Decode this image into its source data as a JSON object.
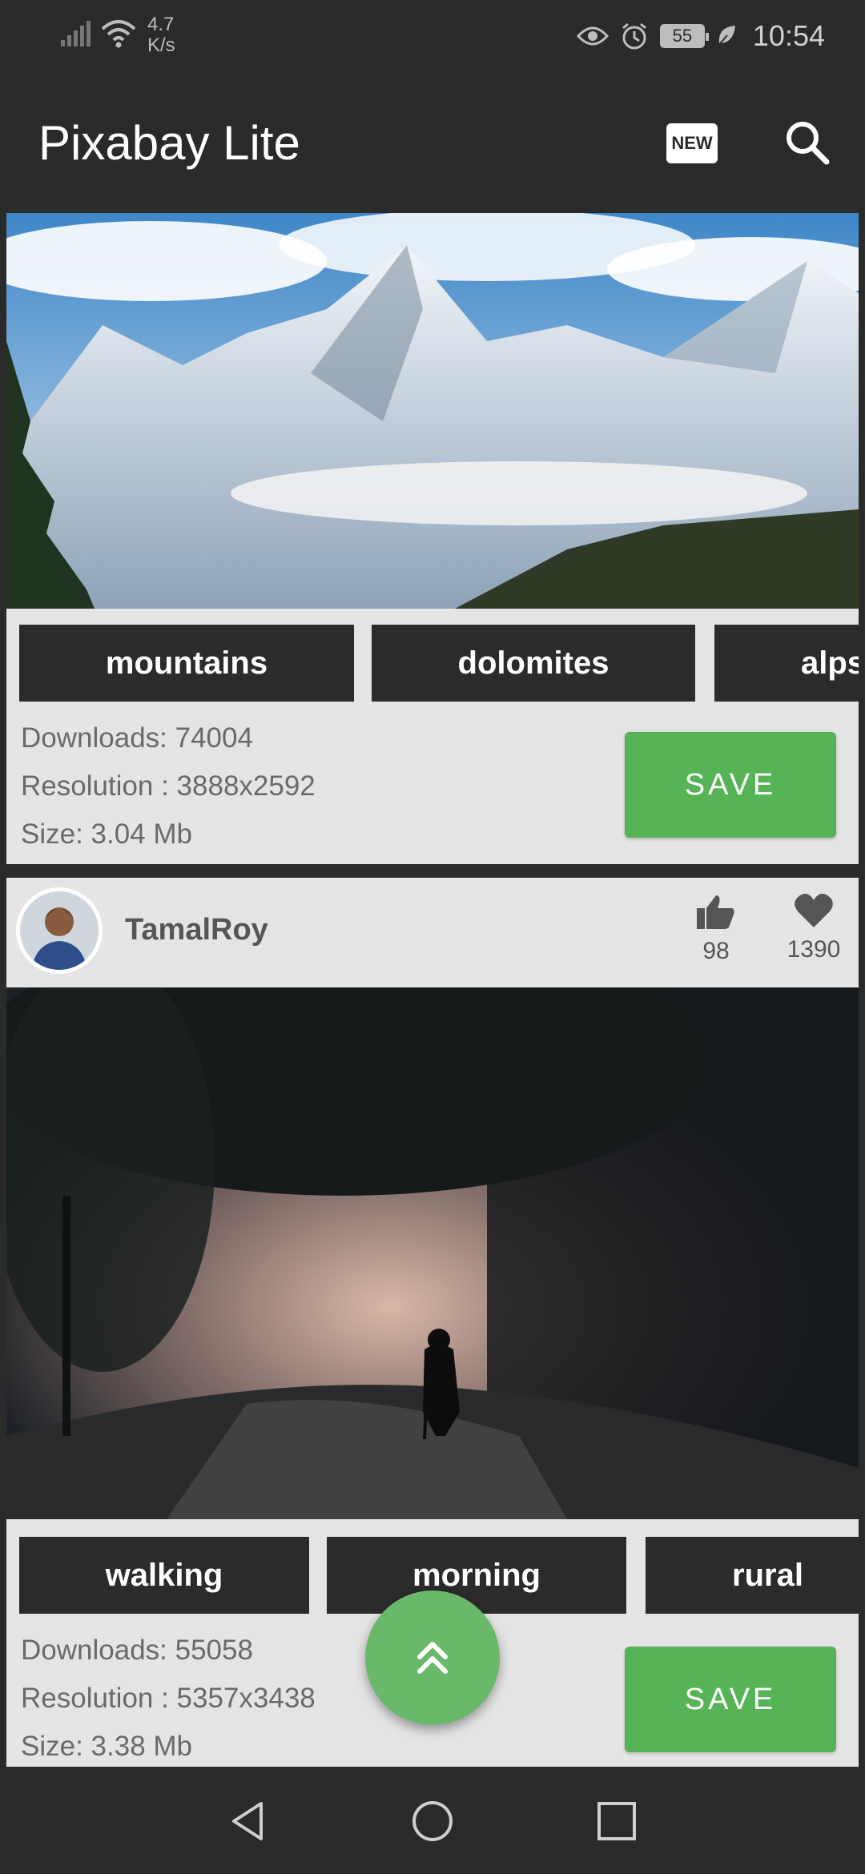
{
  "status_bar": {
    "net_speed_value": "4.7",
    "net_speed_unit": "K/s",
    "battery": "55",
    "time": "10:54"
  },
  "app": {
    "title": "Pixabay Lite",
    "new_badge": "NEW"
  },
  "cards": [
    {
      "tags": [
        "mountains",
        "dolomites",
        "alps"
      ],
      "downloads": "Downloads: 74004",
      "resolution": "Resolution : 3888x2592",
      "size": "Size: 3.04 Mb",
      "save_label": "SAVE"
    },
    {
      "user": "TamalRoy",
      "likes": "98",
      "favorites": "1390",
      "tags": [
        "walking",
        "morning",
        "rural"
      ],
      "downloads": "Downloads: 55058",
      "resolution": "Resolution : 5357x3438",
      "size": "Size: 3.38 Mb",
      "save_label": "SAVE"
    }
  ],
  "colors": {
    "bar_bg": "#2a2a2a",
    "card_bg": "#e5e5e5",
    "tag_bg": "#2b2b2b",
    "accent_green": "#56b356"
  },
  "icons": {
    "search": "search-icon",
    "new": "new-badge-icon",
    "like": "thumbs-up-icon",
    "favorite": "heart-icon",
    "scroll_top": "double-chevron-up-icon",
    "back": "back-triangle-icon",
    "home": "home-circle-icon",
    "recents": "recents-square-icon"
  }
}
